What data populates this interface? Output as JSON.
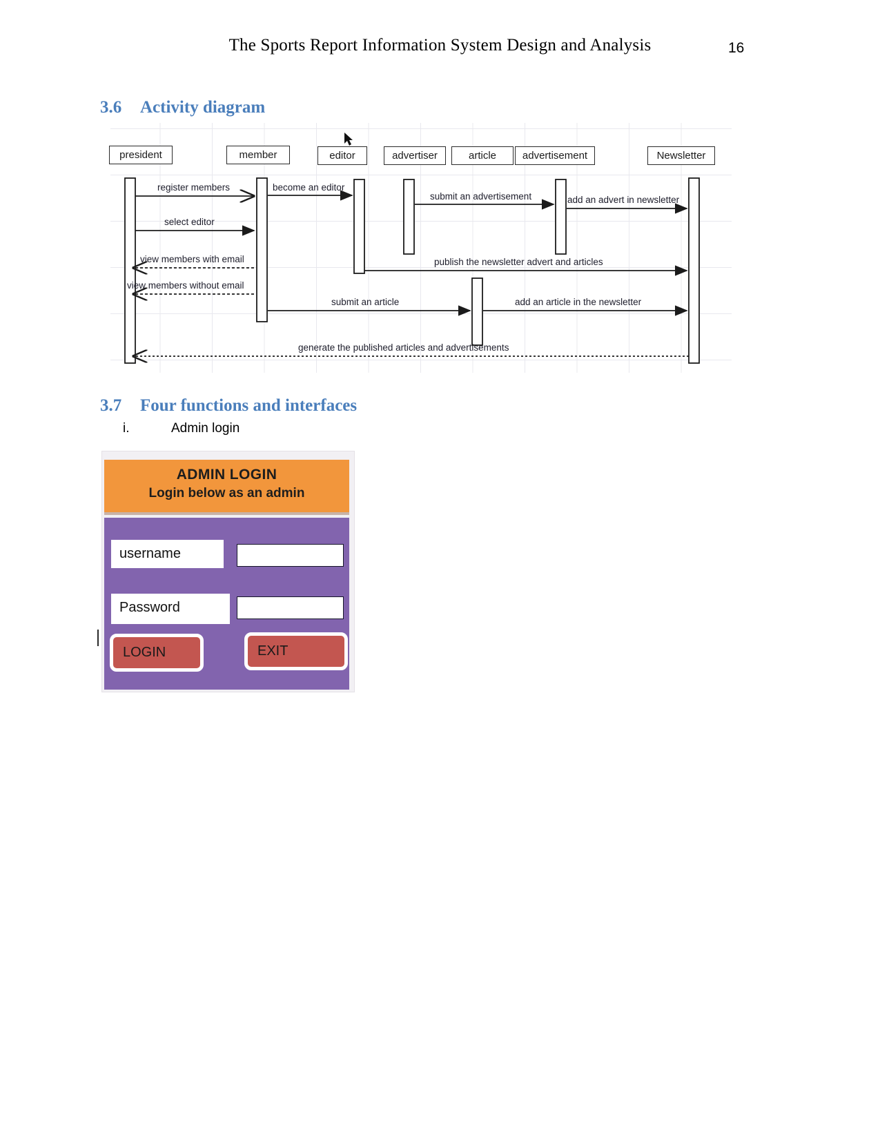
{
  "header": {
    "title": "The Sports Report Information System Design and Analysis",
    "page_number": "16"
  },
  "sections": [
    {
      "number": "3.6",
      "title": "Activity diagram"
    },
    {
      "number": "3.7",
      "title": "Four functions and interfaces"
    }
  ],
  "list": [
    {
      "marker": "i.",
      "label": "Admin login"
    }
  ],
  "sequence_diagram": {
    "participants": [
      {
        "name": "president"
      },
      {
        "name": "member"
      },
      {
        "name": "editor"
      },
      {
        "name": "advertiser"
      },
      {
        "name": "article"
      },
      {
        "name": "advertisement"
      },
      {
        "name": "Newsletter"
      }
    ],
    "messages": [
      {
        "label": "register members",
        "from": "president",
        "to": "member",
        "style": "solid"
      },
      {
        "label": "become an editor",
        "from": "member",
        "to": "editor",
        "style": "solid"
      },
      {
        "label": "submit an advertisement",
        "from": "advertiser",
        "to": "advertisement",
        "style": "solid"
      },
      {
        "label": "add an advert in newsletter",
        "from": "advertisement",
        "to": "Newsletter",
        "style": "solid"
      },
      {
        "label": "select editor",
        "from": "president",
        "to": "member",
        "style": "solid"
      },
      {
        "label": "view members with email",
        "from": "member",
        "to": "president",
        "style": "dashed"
      },
      {
        "label": "publish the newsletter advert and articles",
        "from": "editor",
        "to": "Newsletter",
        "style": "solid"
      },
      {
        "label": "view members without email",
        "from": "member",
        "to": "president",
        "style": "dashed"
      },
      {
        "label": "submit an article",
        "from": "member",
        "to": "article",
        "style": "solid"
      },
      {
        "label": "add an article in the newsletter",
        "from": "article",
        "to": "Newsletter",
        "style": "solid"
      },
      {
        "label": "generate the published articles and advertisements",
        "from": "Newsletter",
        "to": "president",
        "style": "dashed"
      }
    ]
  },
  "admin_login": {
    "title": "ADMIN LOGIN",
    "subtitle": "Login below as an admin",
    "fields": [
      {
        "label": "username",
        "value": ""
      },
      {
        "label": "Password",
        "value": ""
      }
    ],
    "buttons": [
      {
        "label": "LOGIN"
      },
      {
        "label": "EXIT"
      }
    ],
    "colors": {
      "header_bg": "#f2963c",
      "body_bg": "#8264ae",
      "button_bg": "#c35650",
      "field_bg": "#ffffff"
    }
  },
  "theme": {
    "heading_color": "#4a7ebb",
    "text_color": "#000000"
  }
}
